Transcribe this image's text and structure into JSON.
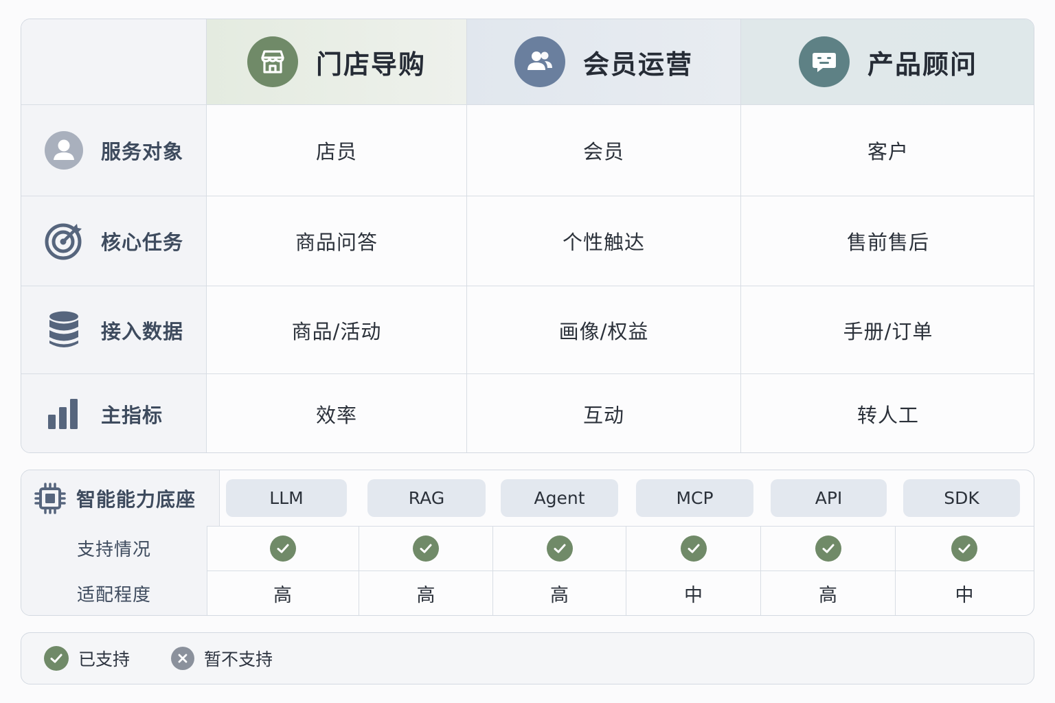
{
  "columns": [
    {
      "label": "门店导购",
      "icon": "store-icon"
    },
    {
      "label": "会员运营",
      "icon": "users-icon"
    },
    {
      "label": "产品顾问",
      "icon": "chat-icon"
    }
  ],
  "rows": [
    {
      "label": "服务对象",
      "icon": "user-icon",
      "values": [
        "店员",
        "会员",
        "客户"
      ]
    },
    {
      "label": "核心任务",
      "icon": "target-icon",
      "values": [
        "商品问答",
        "个性触达",
        "售前售后"
      ]
    },
    {
      "label": "接入数据",
      "icon": "database-icon",
      "values": [
        "商品/活动",
        "画像/权益",
        "手册/订单"
      ]
    },
    {
      "label": "主指标",
      "icon": "bar-chart-icon",
      "values": [
        "效率",
        "互动",
        "转人工"
      ]
    }
  ],
  "capability": {
    "title": "智能能力底座",
    "icon": "chip-icon",
    "items": [
      "LLM",
      "RAG",
      "Agent",
      "MCP",
      "API",
      "SDK"
    ],
    "support_label": "支持情况",
    "support": [
      true,
      true,
      true,
      true,
      true,
      true
    ],
    "fit_label": "适配程度",
    "fit": [
      "高",
      "高",
      "高",
      "中",
      "高",
      "中"
    ]
  },
  "legend": {
    "supported": "已支持",
    "unsupported": "暂不支持"
  },
  "colors": {
    "green": "#708a68",
    "blue": "#6a7f9e",
    "teal": "#5e8185",
    "slate": "#56657d",
    "gray": "#8b919c"
  }
}
